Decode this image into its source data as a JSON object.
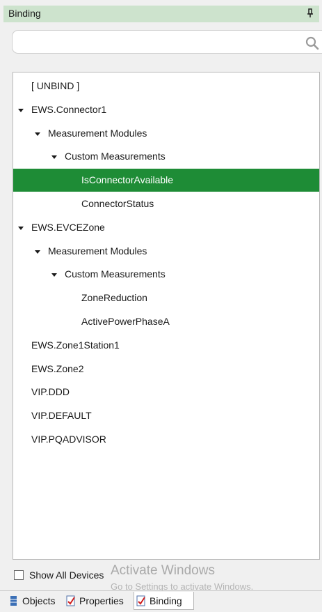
{
  "panel": {
    "title": "Binding",
    "pin_icon": "pin-icon"
  },
  "search": {
    "value": "",
    "placeholder": "",
    "icon": "search-icon"
  },
  "tree": {
    "items": [
      {
        "label": "[ UNBIND ]",
        "level": 0,
        "expanded": false,
        "selected": false
      },
      {
        "label": "EWS.Connector1",
        "level": 0,
        "expanded": true,
        "selected": false
      },
      {
        "label": "Measurement Modules",
        "level": 1,
        "expanded": true,
        "selected": false
      },
      {
        "label": "Custom Measurements",
        "level": 2,
        "expanded": true,
        "selected": false
      },
      {
        "label": "IsConnectorAvailable",
        "level": 3,
        "expanded": false,
        "selected": true
      },
      {
        "label": "ConnectorStatus",
        "level": 3,
        "expanded": false,
        "selected": false
      },
      {
        "label": "EWS.EVCEZone",
        "level": 0,
        "expanded": true,
        "selected": false
      },
      {
        "label": "Measurement Modules",
        "level": 1,
        "expanded": true,
        "selected": false
      },
      {
        "label": "Custom Measurements",
        "level": 2,
        "expanded": true,
        "selected": false
      },
      {
        "label": "ZoneReduction",
        "level": 3,
        "expanded": false,
        "selected": false
      },
      {
        "label": "ActivePowerPhaseA",
        "level": 3,
        "expanded": false,
        "selected": false
      },
      {
        "label": "EWS.Zone1Station1",
        "level": 0,
        "expanded": false,
        "selected": false
      },
      {
        "label": "EWS.Zone2",
        "level": 0,
        "expanded": false,
        "selected": false
      },
      {
        "label": "VIP.DDD",
        "level": 0,
        "expanded": false,
        "selected": false
      },
      {
        "label": "VIP.DEFAULT",
        "level": 0,
        "expanded": false,
        "selected": false
      },
      {
        "label": "VIP.PQADVISOR",
        "level": 0,
        "expanded": false,
        "selected": false
      }
    ]
  },
  "show_all_devices": {
    "label": "Show All Devices",
    "checked": false
  },
  "watermark": {
    "title": "Activate Windows",
    "subtitle": "Go to Settings to activate Windows."
  },
  "tabs": [
    {
      "label": "Objects",
      "icon": "objects-icon",
      "active": false
    },
    {
      "label": "Properties",
      "icon": "properties-icon",
      "active": false
    },
    {
      "label": "Binding",
      "icon": "binding-icon",
      "active": true
    }
  ],
  "colors": {
    "header_bg": "#cde3cd",
    "selection_bg": "#1e8c36",
    "selection_text": "#ffffff"
  }
}
